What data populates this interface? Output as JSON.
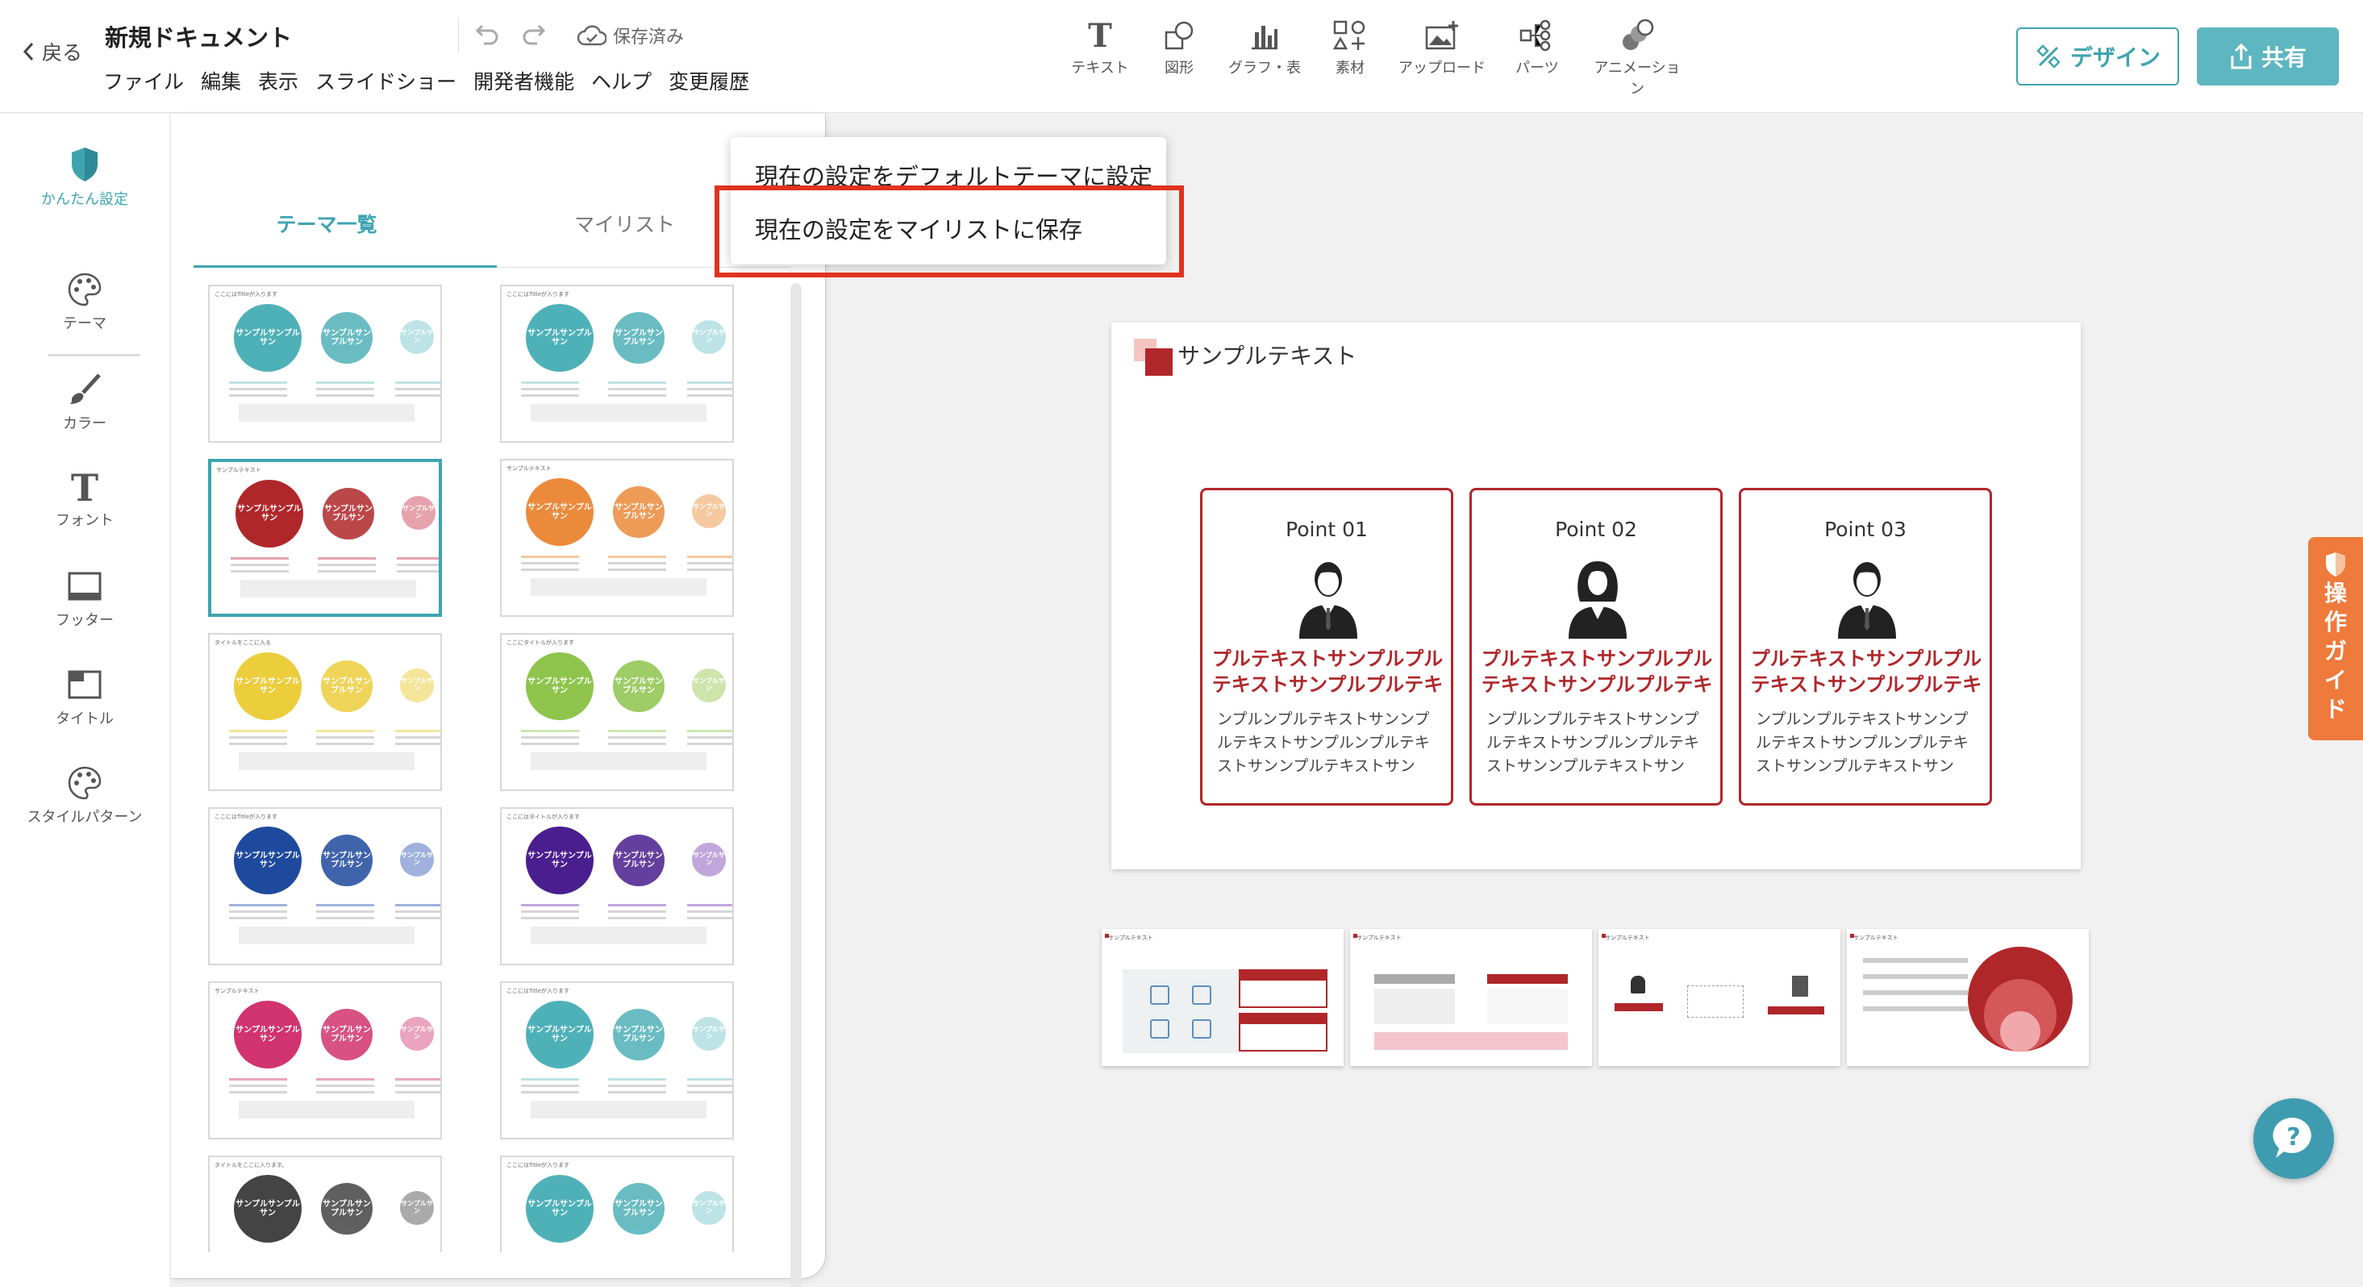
{
  "header": {
    "back_label": "戻る",
    "doc_title": "新規ドキュメント",
    "menu": [
      "ファイル",
      "編集",
      "表示",
      "スライドショー",
      "開発者機能",
      "ヘルプ",
      "変更履歴"
    ],
    "saved_label": "保存済み",
    "tools": [
      {
        "label": "テキスト",
        "icon": "text-tool-icon"
      },
      {
        "label": "図形",
        "icon": "shape-tool-icon"
      },
      {
        "label": "グラフ・表",
        "icon": "chart-tool-icon"
      },
      {
        "label": "素材",
        "icon": "material-tool-icon"
      },
      {
        "label": "アップロード",
        "icon": "upload-tool-icon"
      },
      {
        "label": "パーツ",
        "icon": "parts-tool-icon"
      },
      {
        "label": "アニメーション",
        "icon": "animation-tool-icon"
      }
    ],
    "design_label": "デザイン",
    "share_label": "共有"
  },
  "sidebar": {
    "items": [
      {
        "label": "かんたん設定",
        "icon": "shield-icon"
      },
      {
        "label": "テーマ",
        "icon": "palette-icon"
      },
      {
        "label": "カラー",
        "icon": "brush-icon"
      },
      {
        "label": "フォント",
        "icon": "font-icon"
      },
      {
        "label": "フッター",
        "icon": "footer-icon"
      },
      {
        "label": "タイトル",
        "icon": "title-icon"
      },
      {
        "label": "スタイルパターン",
        "icon": "palette-icon"
      }
    ]
  },
  "panel": {
    "tab_themes": "テーマ一覧",
    "tab_mylist": "マイリスト"
  },
  "dropdown": {
    "item1": "現在の設定をデフォルトテーマに設定",
    "item2": "現在の設定をマイリストに保存"
  },
  "themes": [
    {
      "color": "#4fb1b8",
      "light": "#bde3e6",
      "top": "ここにはTitleが入ります",
      "selected": false
    },
    {
      "color": "#4fb1b8",
      "light": "#bde3e6",
      "top": "ここにはTitleが入ります",
      "selected": false
    },
    {
      "color": "#b0272a",
      "light": "#e6a3ad",
      "top": "サンプルテキスト",
      "selected": true
    },
    {
      "color": "#ec8a3c",
      "light": "#f5c9a0",
      "top": "サンプルテキスト",
      "selected": false
    },
    {
      "color": "#eccd3c",
      "light": "#f4e59a",
      "top": "タイトルをここに入る",
      "selected": false
    },
    {
      "color": "#8ec44c",
      "light": "#cde5ad",
      "top": "ここにタイトルが入ります",
      "selected": false
    },
    {
      "color": "#1e4a9e",
      "light": "#9fb2dd",
      "top": "ここにはTitleが入ります",
      "selected": false
    },
    {
      "color": "#4a1e8e",
      "light": "#c1a6dc",
      "top": "ここにはタイトルが入ります",
      "selected": false
    },
    {
      "color": "#d1346e",
      "light": "#eba4bd",
      "top": "サンプルテキスト",
      "selected": false
    },
    {
      "color": "#4fb1b8",
      "light": "#bde3e6",
      "top": "ここにはTitleが入ります",
      "selected": false
    },
    {
      "color": "#444444",
      "light": "#aaaaaa",
      "top": "タイトルをここに入ります。",
      "selected": false
    },
    {
      "color": "#4fb1b8",
      "light": "#bde3e6",
      "top": "ここにはTitleが入ります",
      "selected": false
    }
  ],
  "theme_circle_labels": [
    "サンプルサンプルサン",
    "サンプルサンプルサン",
    "サンプルサン"
  ],
  "slide": {
    "title": "サンプルテキスト",
    "accent": "#b0272a",
    "points": [
      {
        "label": "Point 01",
        "heading": "プルテキストサンプルプルテキストサンプルプルテキ",
        "body": "ンプルンプルテキストサンンプルテキストサンプルンプルテキストサンンプルテキストサン",
        "person": "male"
      },
      {
        "label": "Point 02",
        "heading": "プルテキストサンプルプルテキストサンプルプルテキ",
        "body": "ンプルンプルテキストサンンプルテキストサンプルンプルテキストサンンプルテキストサン",
        "person": "female"
      },
      {
        "label": "Point 03",
        "heading": "プルテキストサンプルプルテキストサンプルプルテキ",
        "body": "ンプルンプルテキストサンンプルテキストサンプルンプルテキストサンンプルテキストサン",
        "person": "male"
      }
    ]
  },
  "filmstrip": [
    {
      "title": "サンプルテキスト"
    },
    {
      "title": "サンプルテキスト"
    },
    {
      "title": "サンプルテキスト"
    },
    {
      "title": "サンプルテキスト"
    }
  ],
  "guide_label": "操作ガイド"
}
